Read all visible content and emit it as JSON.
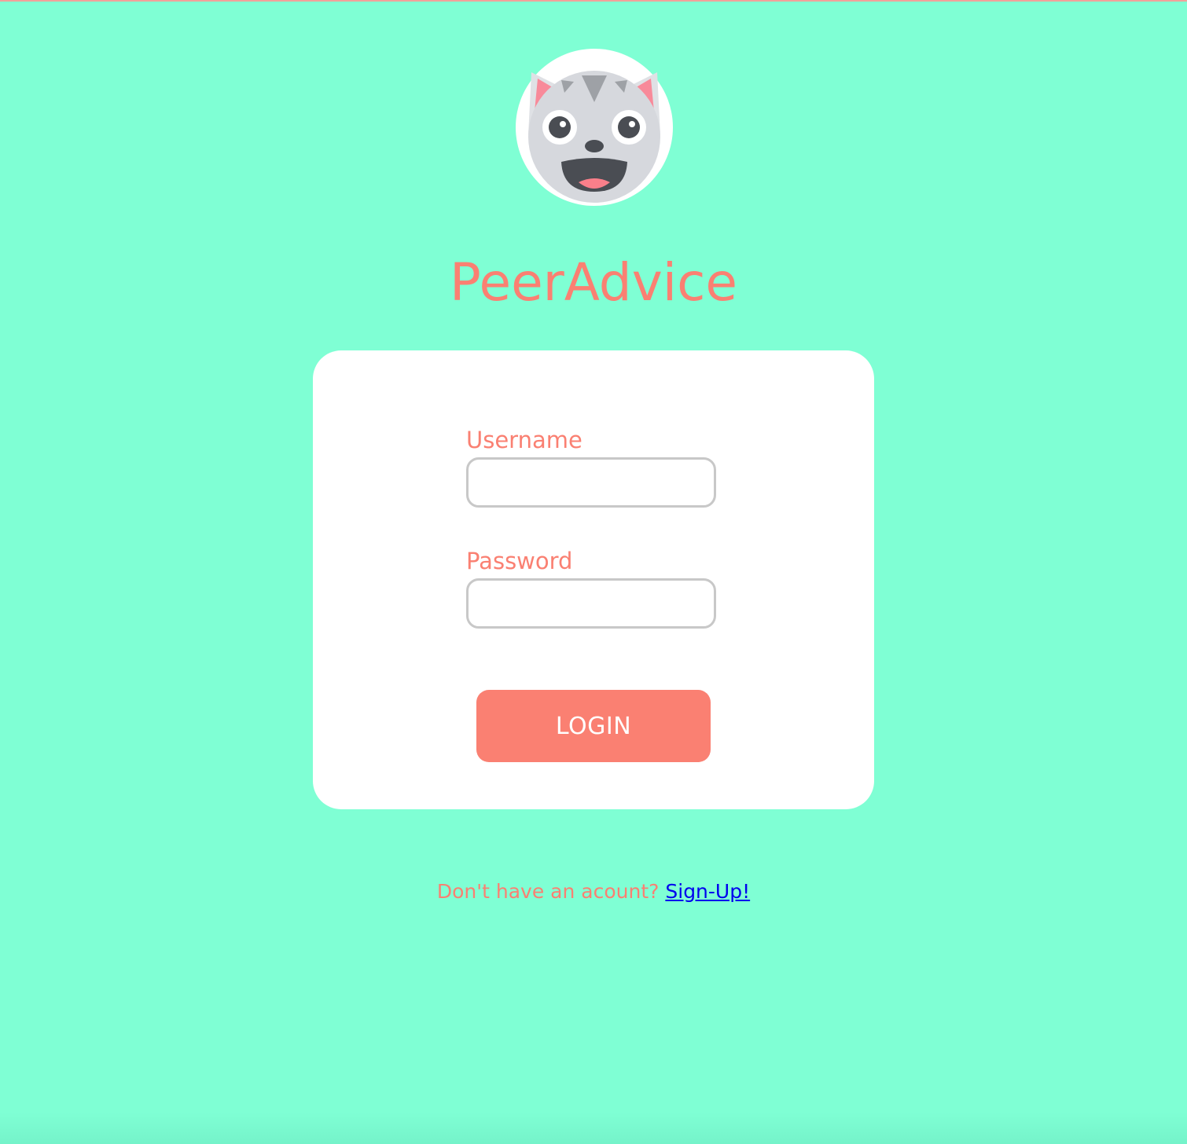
{
  "app": {
    "title": "PeerAdvice",
    "logo_icon": "cat-face-icon"
  },
  "form": {
    "username_label": "Username",
    "username_value": "",
    "password_label": "Password",
    "password_value": "",
    "login_label": "LOGIN"
  },
  "footer": {
    "prompt": "Don't have an acount?",
    "signup_label": "Sign-Up!"
  },
  "colors": {
    "background": "#7fffd4",
    "accent": "#fa8072",
    "card": "#ffffff",
    "link": "#0000ee",
    "input_border": "#c8c8c8"
  }
}
